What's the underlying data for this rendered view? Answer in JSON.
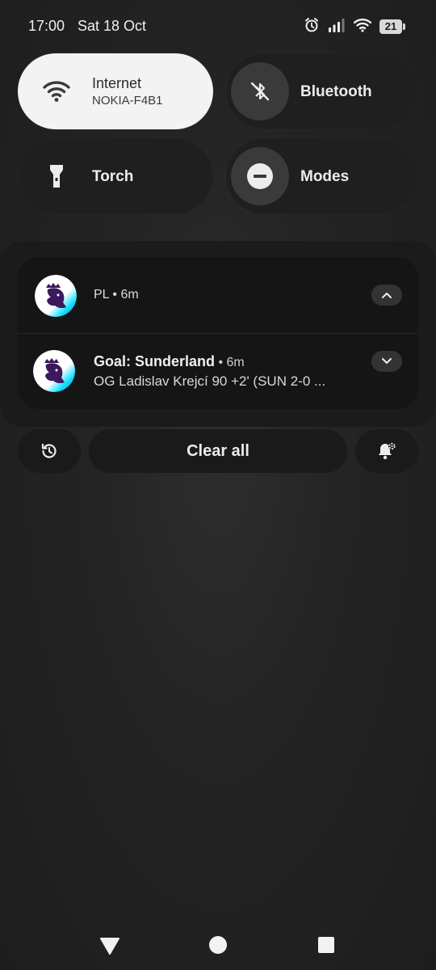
{
  "status_bar": {
    "time": "17:00",
    "date": "Sat 18 Oct",
    "battery_level": "21",
    "icons": [
      "alarm-icon",
      "signal-icon",
      "wifi-icon",
      "battery-icon"
    ]
  },
  "quick_settings": {
    "tiles": [
      {
        "label": "Internet",
        "subtitle": "NOKIA-F4B1",
        "icon": "wifi-icon",
        "active": true
      },
      {
        "label": "Bluetooth",
        "icon": "bluetooth-off-icon",
        "active": false
      },
      {
        "label": "Torch",
        "icon": "torch-icon",
        "active": false
      },
      {
        "label": "Modes",
        "icon": "do-not-disturb-icon",
        "active": false
      }
    ]
  },
  "notifications": {
    "group": {
      "app": "PL",
      "time": "6m"
    },
    "item": {
      "title": "Goal: Sunderland",
      "separator": " • ",
      "time": "6m",
      "body": "OG Ladislav Krejcí 90 +2' (SUN 2-0 ..."
    }
  },
  "actions": {
    "clear_all": "Clear all"
  },
  "colors": {
    "active_tile": "#f3f3f3",
    "tile": "#1f1f1f",
    "background": "#242424",
    "pl_purple": "#3d185c"
  }
}
